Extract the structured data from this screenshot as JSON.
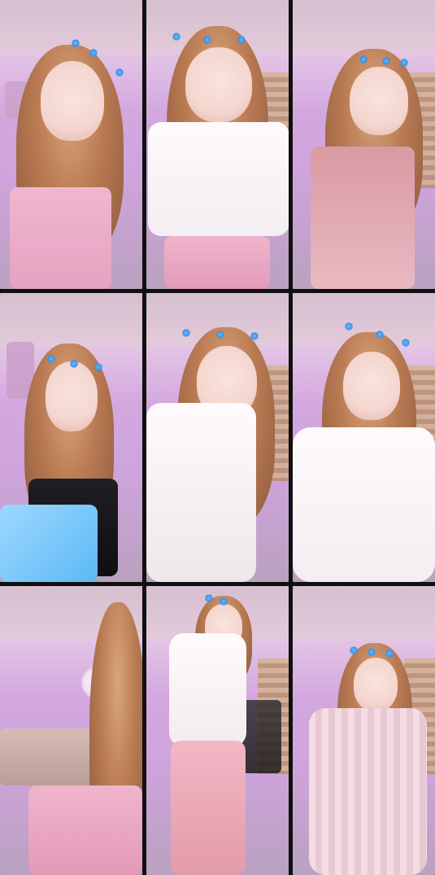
{
  "photos": [
    {
      "label": ""
    },
    {
      "label": ""
    },
    {
      "label": ""
    },
    {
      "label": ""
    },
    {
      "label": ""
    },
    {
      "label": ""
    },
    {
      "label": ""
    },
    {
      "label": ""
    },
    {
      "label": ""
    }
  ]
}
